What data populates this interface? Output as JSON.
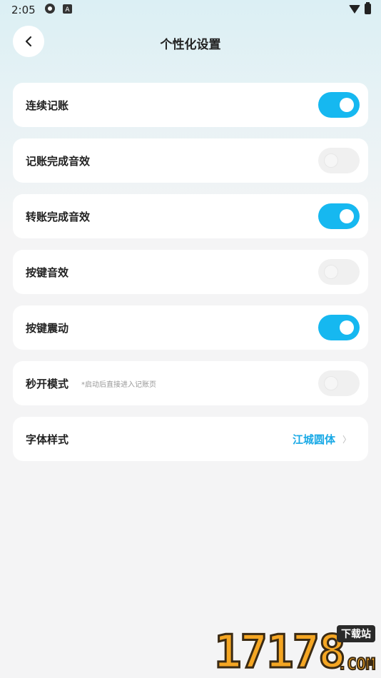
{
  "status_bar": {
    "time": "2:05",
    "icons": [
      "settings-icon",
      "a-icon"
    ],
    "right_icons": [
      "wifi-icon",
      "battery-icon"
    ]
  },
  "header": {
    "title": "个性化设置",
    "back_icon": "chevron-left-icon"
  },
  "settings": [
    {
      "label": "连续记账",
      "toggle": true
    },
    {
      "label": "记账完成音效",
      "toggle": false
    },
    {
      "label": "转账完成音效",
      "toggle": true
    },
    {
      "label": "按键音效",
      "toggle": false
    },
    {
      "label": "按键震动",
      "toggle": true
    },
    {
      "label": "秒开模式",
      "note": "*启动后直接进入记账页",
      "toggle": false
    },
    {
      "label": "字体样式",
      "value": "江城圆体"
    }
  ],
  "colors": {
    "accent": "#16b8f0",
    "font_value": "#19a9e6",
    "background": "#f4f4f5"
  },
  "watermark": {
    "number": "17178",
    "badge": "下载站",
    "suffix": ".COM"
  }
}
